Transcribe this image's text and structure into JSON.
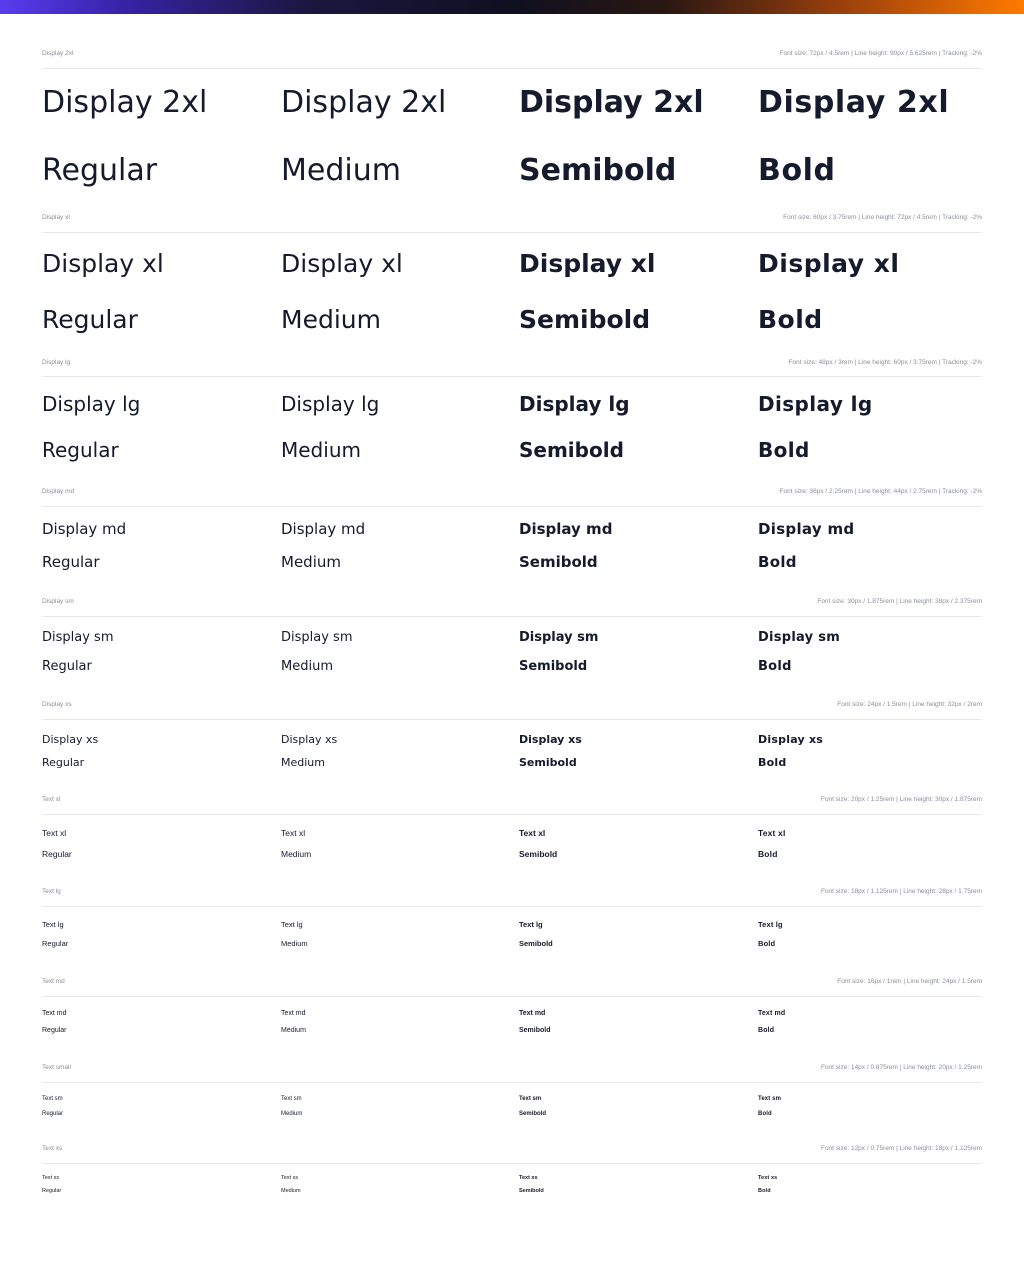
{
  "sections": [
    {
      "name": "Display 2xl",
      "spec": "Font size: 72px / 4.5rem | Line height: 90px / 5.625rem | Tracking: -2%",
      "samples": [
        {
          "title": "Display 2xl",
          "weight": "Regular"
        },
        {
          "title": "Display 2xl",
          "weight": "Medium"
        },
        {
          "title": "Display 2xl",
          "weight": "Semibold"
        },
        {
          "title": "Display 2xl",
          "weight": "Bold"
        }
      ]
    },
    {
      "name": "Display xl",
      "spec": "Font size: 60px / 3.75rem | Line height: 72px / 4.5rem | Tracking: -2%",
      "samples": [
        {
          "title": "Display xl",
          "weight": "Regular"
        },
        {
          "title": "Display xl",
          "weight": "Medium"
        },
        {
          "title": "Display xl",
          "weight": "Semibold"
        },
        {
          "title": "Display xl",
          "weight": "Bold"
        }
      ]
    },
    {
      "name": "Display lg",
      "spec": "Font size: 48px / 3rem | Line height: 60px / 3.75rem | Tracking: -2%",
      "samples": [
        {
          "title": "Display lg",
          "weight": "Regular"
        },
        {
          "title": "Display lg",
          "weight": "Medium"
        },
        {
          "title": "Display lg",
          "weight": "Semibold"
        },
        {
          "title": "Display lg",
          "weight": "Bold"
        }
      ]
    },
    {
      "name": "Display md",
      "spec": "Font size: 36px / 2.25rem | Line height: 44px / 2.75rem | Tracking: -2%",
      "samples": [
        {
          "title": "Display md",
          "weight": "Regular"
        },
        {
          "title": "Display md",
          "weight": "Medium"
        },
        {
          "title": "Display md",
          "weight": "Semibold"
        },
        {
          "title": "Display md",
          "weight": "Bold"
        }
      ]
    },
    {
      "name": "Display sm",
      "spec": "Font size: 30px / 1.875rem | Line height: 38px / 2.375rem",
      "samples": [
        {
          "title": "Display sm",
          "weight": "Regular"
        },
        {
          "title": "Display sm",
          "weight": "Medium"
        },
        {
          "title": "Display sm",
          "weight": "Semibold"
        },
        {
          "title": "Display sm",
          "weight": "Bold"
        }
      ]
    },
    {
      "name": "Display xs",
      "spec": "Font size: 24px / 1.5rem | Line height: 32px / 2rem",
      "samples": [
        {
          "title": "Display xs",
          "weight": "Regular"
        },
        {
          "title": "Display xs",
          "weight": "Medium"
        },
        {
          "title": "Display xs",
          "weight": "Semibold"
        },
        {
          "title": "Display xs",
          "weight": "Bold"
        }
      ]
    },
    {
      "name": "Text xl",
      "spec": "Font size: 20px / 1.25rem | Line height: 30px / 1.875rem",
      "samples": [
        {
          "title": "Text xl",
          "weight": "Regular"
        },
        {
          "title": "Text xl",
          "weight": "Medium"
        },
        {
          "title": "Text xl",
          "weight": "Semibold"
        },
        {
          "title": "Text xl",
          "weight": "Bold"
        }
      ]
    },
    {
      "name": "Text lg",
      "spec": "Font size: 18px / 1.125rem | Line height: 28px / 1.75rem",
      "samples": [
        {
          "title": "Text lg",
          "weight": "Regular"
        },
        {
          "title": "Text lg",
          "weight": "Medium"
        },
        {
          "title": "Text lg",
          "weight": "Semibold"
        },
        {
          "title": "Text lg",
          "weight": "Bold"
        }
      ]
    },
    {
      "name": "Text md",
      "spec": "Font size: 16px / 1rem | Line height: 24px / 1.5rem",
      "samples": [
        {
          "title": "Text md",
          "weight": "Regular"
        },
        {
          "title": "Text md",
          "weight": "Medium"
        },
        {
          "title": "Text md",
          "weight": "Semibold"
        },
        {
          "title": "Text md",
          "weight": "Bold"
        }
      ]
    },
    {
      "name": "Text small",
      "spec": "Font size: 14px / 0.875rem | Line height: 20px / 1.25rem",
      "samples": [
        {
          "title": "Text sm",
          "weight": "Regular"
        },
        {
          "title": "Text sm",
          "weight": "Medium"
        },
        {
          "title": "Text sm",
          "weight": "Semibold"
        },
        {
          "title": "Text sm",
          "weight": "Bold"
        }
      ]
    },
    {
      "name": "Text xs",
      "spec": "Font size: 12px / 0.75rem | Line height: 18px / 1.125rem",
      "samples": [
        {
          "title": "Text xs",
          "weight": "Regular"
        },
        {
          "title": "Text xs",
          "weight": "Medium"
        },
        {
          "title": "Text xs",
          "weight": "Semibold"
        },
        {
          "title": "Text xs",
          "weight": "Bold"
        }
      ]
    }
  ]
}
